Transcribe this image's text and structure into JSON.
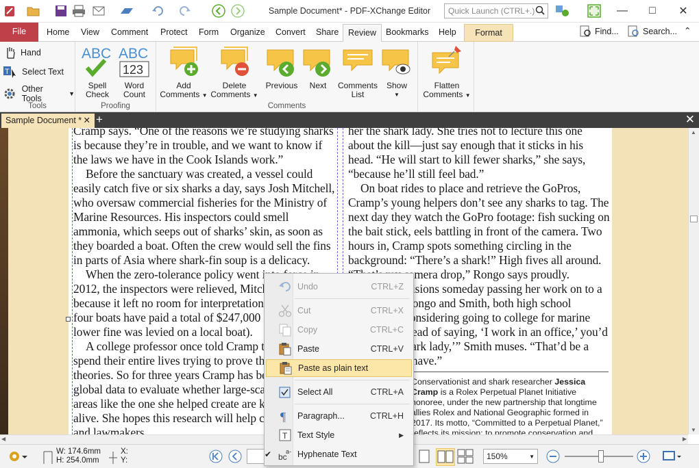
{
  "app": {
    "title": "Sample Document* - PDF-XChange Editor",
    "quick_launch_placeholder": "Quick Launch (CTRL+.)"
  },
  "tabs": [
    "File",
    "Home",
    "View",
    "Comment",
    "Protect",
    "Form",
    "Organize",
    "Convert",
    "Share",
    "Review",
    "Bookmarks",
    "Help",
    "Format"
  ],
  "tab_right": {
    "find": "Find...",
    "search": "Search..."
  },
  "ribbon": {
    "tools": {
      "label": "Tools",
      "hand": "Hand",
      "select_text": "Select Text",
      "other_tools": "Other Tools"
    },
    "proofing": {
      "label": "Proofing",
      "spell_check_1": "Spell",
      "spell_check_2": "Check",
      "word_count_1": "Word",
      "word_count_2": "Count",
      "abc": "ABC",
      "num": "123"
    },
    "comments": {
      "label": "Comments",
      "add_1": "Add",
      "add_2": "Comments",
      "delete_1": "Delete",
      "delete_2": "Comments",
      "previous": "Previous",
      "next": "Next",
      "list_1": "Comments",
      "list_2": "List",
      "show": "Show"
    },
    "flatten": {
      "line1": "Flatten",
      "line2": "Comments"
    }
  },
  "doc_tab": {
    "label": "Sample Document *",
    "close": "✕"
  },
  "document": {
    "left_paragraphs": [
      {
        "text": "Cramp says. “One of the reasons we’re studying sharks is because they’re in trouble, and we want to know if the laws we have in the Cook Islands work.”",
        "indent": false
      },
      {
        "text": "Before the sanctuary was created, a vessel could easily catch five or six sharks a day, says Josh Mitchell, who oversaw commercial fisheries for the Ministry of Marine Resources. His inspectors could smell ammonia, which seeps out of sharks’ skin, as soon as they boarded a boat. Often the crew would sell the fins in parts of Asia where shark-fin soup is a delicacy.",
        "indent": true
      },
      {
        "text": "When the zero-tolerance policy went into force in 2012, the inspectors were relieved, Mitchell says, because it left no room for interpretation. Since then four boats have paid a total of $247,000 in fines; a lower fine was levied on a local boat).",
        "indent": true
      },
      {
        "text": "A college professor once told Cramp that scientists spend their entire lives trying to prove their own theories. So for three years Cramp has been crunching global data to evaluate whether large-scale protected areas like the one she helped create are keeping sharks alive. She hopes this research will help conservationists and lawmakers",
        "indent": true
      }
    ],
    "right_paragraphs": [
      {
        "text": "her the shark lady. She tries not to lecture this one about the kill—just say enough that it sticks in his head. “He will start to kill fewer sharks,” she says, “because he’ll still feel bad.”",
        "indent": false
      },
      {
        "text": "On boat rides to place and retrieve the GoPros, Cramp’s young helpers don’t see any sharks to tag. The next day they watch the GoPro footage: fish sucking on the bait stick, eels battling in front of the camera. Two hours in, Cramp spots something circling in the background: “There’s a shark!” High fives all around. “That’s my camera drop,” Rongo says proudly.",
        "indent": true
      },
      {
        "text": "Rongo envisions someday passing her work on to a new leader. Rongo and Smith, both high school seniors, are considering going to college for marine biology. “Instead of saying, ‘I work in an office,’ you’d say, ‘I’m a shark lady,’” Smith muses. “That’d be a cool name to have.”",
        "indent": true
      }
    ],
    "caption_pre": "Conservationist and shark researcher ",
    "caption_bold": "Jessica Cramp",
    "caption_post": " is a Rolex Perpetual Planet Initiative honoree, under the new partnership that longtime allies Rolex and National Geographic formed in 2017. Its motto, “Committed to a Perpetual Planet,” reflects its mission: to promote conservation and exploration of Earth’s oceans, poles, and mountains. Learn more at nationalgeographic.com/environment/perpetual-planet"
  },
  "context_menu": [
    {
      "label": "Undo",
      "shortcut": "CTRL+Z",
      "disabled": true,
      "icon": "undo-icon"
    },
    {
      "label": "Cut",
      "shortcut": "CTRL+X",
      "disabled": true,
      "icon": "scissors-icon"
    },
    {
      "label": "Copy",
      "shortcut": "CTRL+C",
      "disabled": true,
      "icon": "copy-icon"
    },
    {
      "label": "Paste",
      "shortcut": "CTRL+V",
      "disabled": false,
      "icon": "paste-icon"
    },
    {
      "label": "Paste as plain text",
      "shortcut": "",
      "disabled": false,
      "icon": "paste-plain-icon",
      "highlighted": true
    },
    {
      "label": "Select All",
      "shortcut": "CTRL+A",
      "disabled": false,
      "icon": "select-all-icon"
    },
    {
      "label": "Paragraph...",
      "shortcut": "CTRL+H",
      "disabled": false,
      "icon": "paragraph-icon"
    },
    {
      "label": "Text Style",
      "shortcut": "",
      "disabled": false,
      "icon": "text-style-icon",
      "submenu": true
    },
    {
      "label": "Hyphenate Text",
      "shortcut": "",
      "disabled": false,
      "icon": "hyphenate-icon",
      "checked": true
    }
  ],
  "status": {
    "w": "W: 174.6mm",
    "h": "H: 254.0mm",
    "x": "X:",
    "y": "Y:",
    "zoom": "150%"
  },
  "colors": {
    "file_tab": "#c0404a",
    "format_tab": "#f6e3b8",
    "workspace": "#f3e1b8",
    "accent_green": "#5aab2e",
    "highlight": "#fde7a8"
  }
}
